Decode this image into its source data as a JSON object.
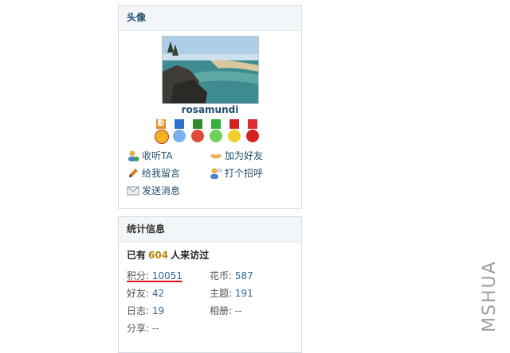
{
  "avatar_panel": {
    "title": "头像",
    "username": "rosamundi",
    "medals": [
      {
        "icon": "diligence-medal",
        "label": "勤",
        "ribbon": "#e08a1e",
        "disc": "#f3b21f"
      },
      {
        "icon": "face-medal",
        "label": "",
        "ribbon": "#2f6fc9",
        "disc": "#77b0ea"
      },
      {
        "icon": "wreath-medal",
        "label": "",
        "ribbon": "#2e8b2e",
        "disc": "#e04a3b"
      },
      {
        "icon": "leaf-medal",
        "label": "",
        "ribbon": "#36b03a",
        "disc": "#6ed15b"
      },
      {
        "icon": "star-medal",
        "label": "",
        "ribbon": "#d02222",
        "disc": "#f2cf2c"
      },
      {
        "icon": "lantern-medal",
        "label": "",
        "ribbon": "#e02c2c",
        "disc": "#d61f1f"
      }
    ],
    "actions": {
      "follow": "收听TA",
      "add_friend": "加为好友",
      "leave_message": "给我留言",
      "greet": "打个招呼",
      "send_message": "发送消息"
    }
  },
  "stats_panel": {
    "title": "统计信息",
    "visits_prefix": "已有",
    "visits_count": "604",
    "visits_suffix": "人来访过",
    "points_label": "积分:",
    "points_value": "10051",
    "coins_label": "花币:",
    "coins_value": "587",
    "friends_label": "好友:",
    "friends_value": "42",
    "threads_label": "主题:",
    "threads_value": "191",
    "blogs_label": "日志:",
    "blogs_value": "19",
    "albums_label": "相册:",
    "albums_value": "--",
    "shares_label": "分享:",
    "shares_value": "--"
  },
  "watermark": "MSHUA",
  "colors": {
    "link": "#336699",
    "heading": "#1f4f6e",
    "highlight": "#b8860b",
    "mark": "#d4141c"
  }
}
